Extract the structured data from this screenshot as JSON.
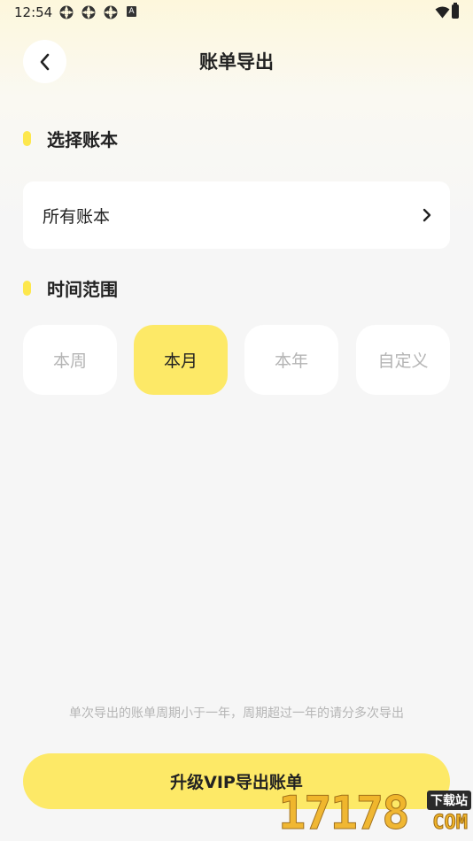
{
  "status_bar": {
    "time": "12:54",
    "notification_icons": [
      "sync-icon",
      "sync-icon",
      "sync-icon",
      "a-icon"
    ],
    "a_icon_text": "A"
  },
  "header": {
    "title": "账单导出"
  },
  "section_book": {
    "title": "选择账本",
    "selected_book": "所有账本"
  },
  "section_range": {
    "title": "时间范围",
    "options": [
      {
        "label": "本周",
        "active": false
      },
      {
        "label": "本月",
        "active": true
      },
      {
        "label": "本年",
        "active": false
      },
      {
        "label": "自定义",
        "active": false
      }
    ]
  },
  "note": "单次导出的账单周期小于一年，周期超过一年的请分多次导出",
  "upgrade_button": "升级VIP导出账单",
  "watermark": {
    "digits": "17178",
    "tag": "下载站",
    "domain": "COM"
  },
  "colors": {
    "accent": "#fde967",
    "marker": "#fde74c",
    "muted_text": "#b4b4b4"
  }
}
